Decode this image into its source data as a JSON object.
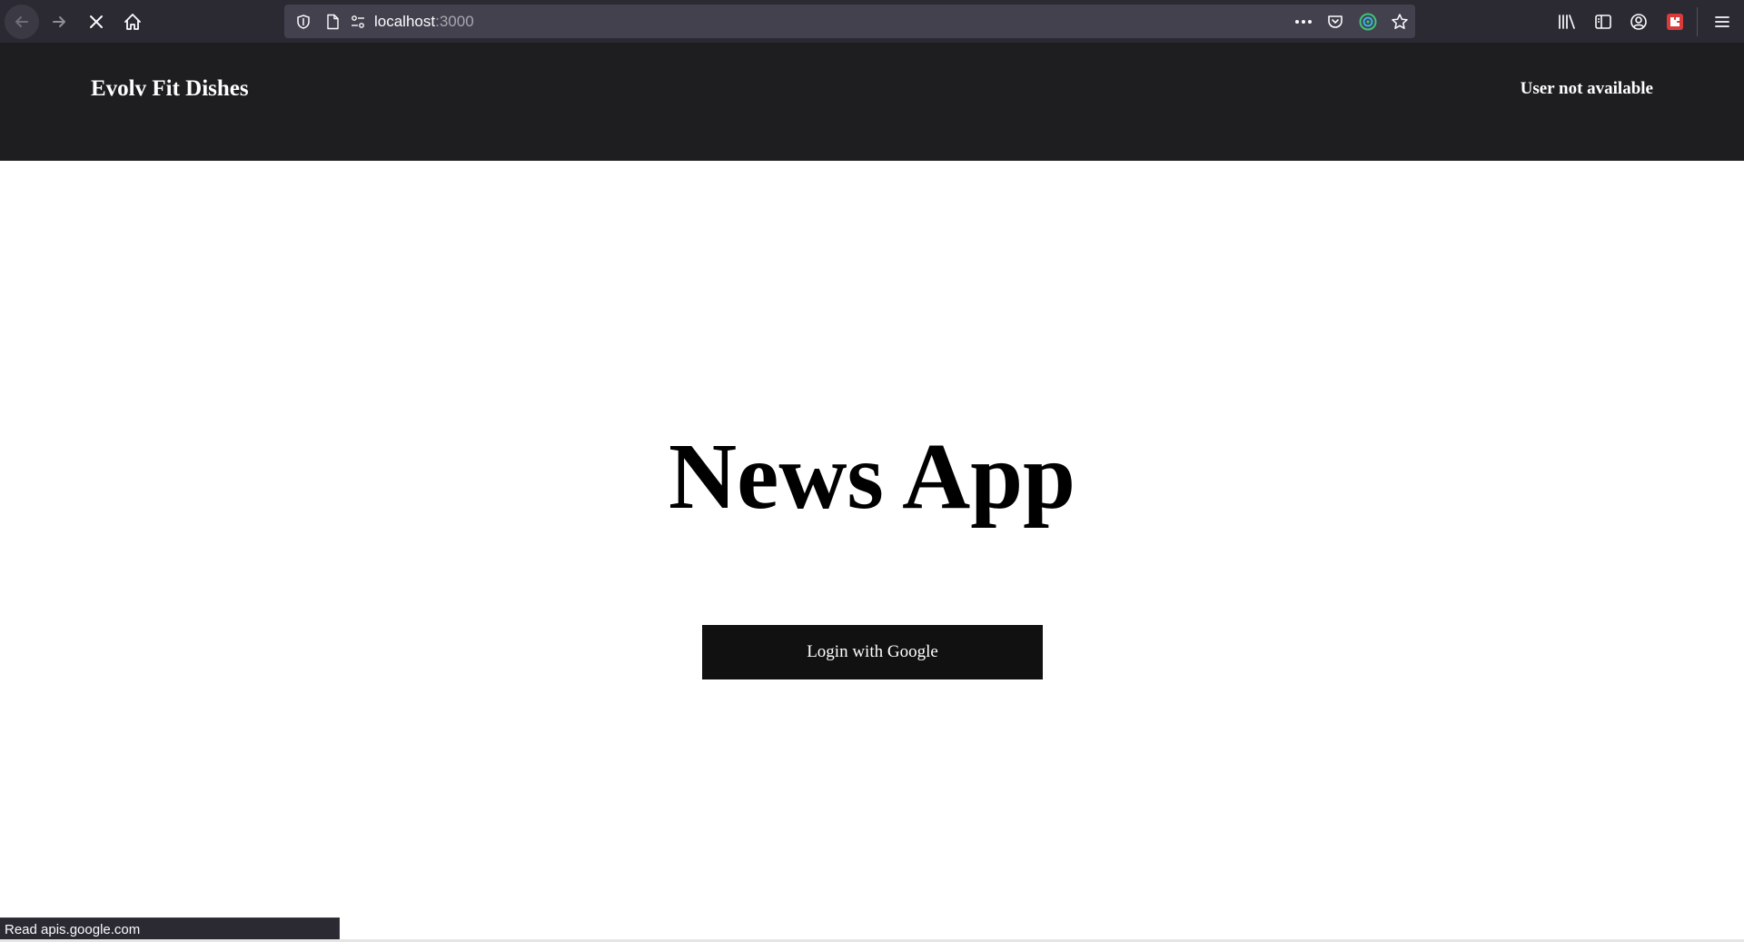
{
  "browser": {
    "url_host": "localhost",
    "url_port": ":3000",
    "toolbar_icons": [
      "back-arrow-icon",
      "forward-arrow-icon",
      "stop-loading-icon",
      "home-icon",
      "tracking-shield-icon",
      "page-icon",
      "permissions-icon",
      "more-actions-icon",
      "pocket-icon",
      "extension-icon",
      "bookmark-star-icon",
      "library-icon",
      "sidebar-icon",
      "account-icon",
      "extension-puzzle-icon",
      "menu-icon"
    ],
    "status_text": "Read apis.google.com"
  },
  "header": {
    "brand": "Evolv Fit Dishes",
    "user_status": "User not available"
  },
  "main": {
    "title": "News App",
    "login_label": "Login with Google"
  },
  "colors": {
    "header_bg": "#1e1e20",
    "button_bg": "#111111",
    "browser_chrome": "#2b2a33",
    "urlbar_bg": "#42414d"
  }
}
